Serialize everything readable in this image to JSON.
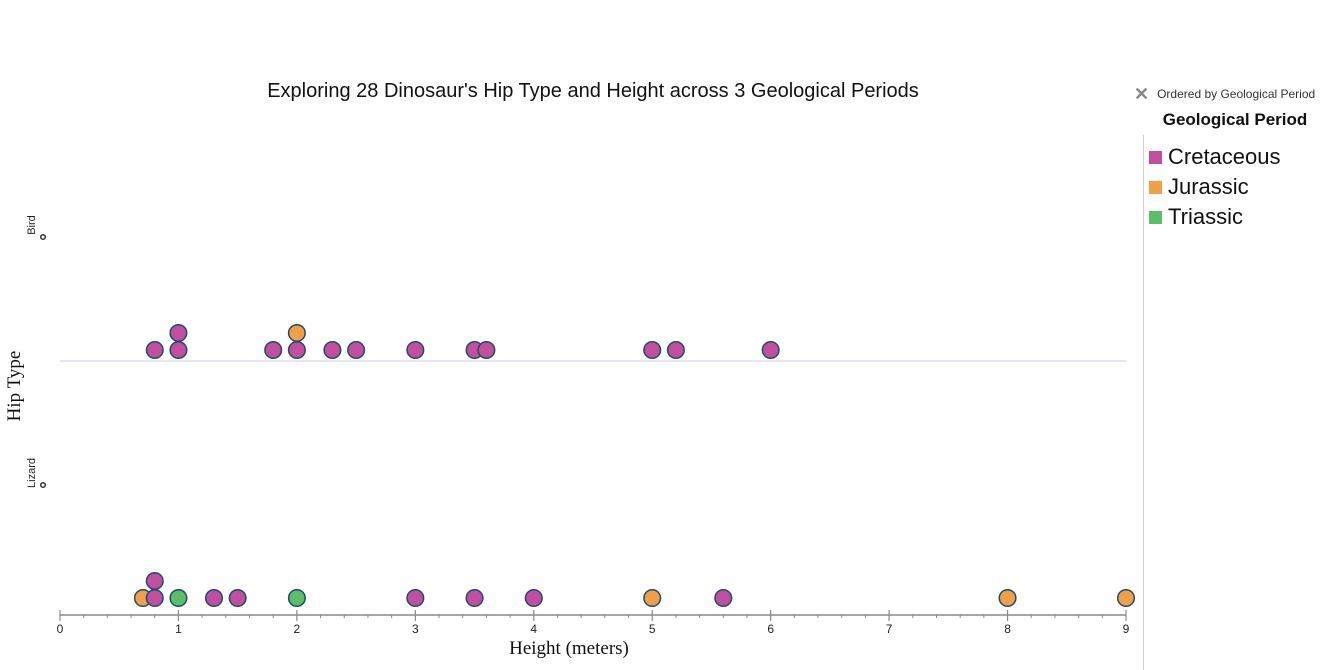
{
  "legend": {
    "ordered_by": "Ordered by Geological Period",
    "close_icon": "close-icon",
    "title": "Geological Period",
    "items": [
      {
        "label": "Cretaceous",
        "color": "#c0509f"
      },
      {
        "label": "Jurassic",
        "color": "#f0a04b"
      },
      {
        "label": "Triassic",
        "color": "#5cbe6a"
      }
    ]
  },
  "chart_data": {
    "type": "scatter",
    "subtype": "dot-plot (stacked)",
    "title": "Exploring 28 Dinosaur's Hip Type and Height across 3 Geological Periods",
    "xlabel": "Height (meters)",
    "ylabel": "Hip Type",
    "xlim": [
      0,
      9
    ],
    "x_ticks": [
      0,
      1,
      2,
      3,
      4,
      5,
      6,
      7,
      8,
      9
    ],
    "x_minor_step": 0.2,
    "categories": [
      "Bird",
      "Lizard"
    ],
    "legend_position": "right",
    "colors": {
      "Cretaceous": "#c0509f",
      "Jurassic": "#f0a04b",
      "Triassic": "#5cbe6a"
    },
    "points": [
      {
        "hip": "Bird",
        "height": 0.8,
        "period": "Cretaceous"
      },
      {
        "hip": "Bird",
        "height": 1.0,
        "period": "Cretaceous"
      },
      {
        "hip": "Bird",
        "height": 1.0,
        "period": "Cretaceous"
      },
      {
        "hip": "Bird",
        "height": 1.8,
        "period": "Cretaceous"
      },
      {
        "hip": "Bird",
        "height": 2.0,
        "period": "Cretaceous"
      },
      {
        "hip": "Bird",
        "height": 2.0,
        "period": "Jurassic"
      },
      {
        "hip": "Bird",
        "height": 2.3,
        "period": "Cretaceous"
      },
      {
        "hip": "Bird",
        "height": 2.5,
        "period": "Cretaceous"
      },
      {
        "hip": "Bird",
        "height": 3.0,
        "period": "Cretaceous"
      },
      {
        "hip": "Bird",
        "height": 3.5,
        "period": "Cretaceous"
      },
      {
        "hip": "Bird",
        "height": 3.6,
        "period": "Cretaceous"
      },
      {
        "hip": "Bird",
        "height": 5.0,
        "period": "Cretaceous"
      },
      {
        "hip": "Bird",
        "height": 5.2,
        "period": "Cretaceous"
      },
      {
        "hip": "Bird",
        "height": 6.0,
        "period": "Cretaceous"
      },
      {
        "hip": "Lizard",
        "height": 0.7,
        "period": "Jurassic"
      },
      {
        "hip": "Lizard",
        "height": 0.8,
        "period": "Cretaceous"
      },
      {
        "hip": "Lizard",
        "height": 0.8,
        "period": "Cretaceous"
      },
      {
        "hip": "Lizard",
        "height": 1.0,
        "period": "Triassic"
      },
      {
        "hip": "Lizard",
        "height": 1.3,
        "period": "Cretaceous"
      },
      {
        "hip": "Lizard",
        "height": 1.5,
        "period": "Cretaceous"
      },
      {
        "hip": "Lizard",
        "height": 2.0,
        "period": "Triassic"
      },
      {
        "hip": "Lizard",
        "height": 3.0,
        "period": "Cretaceous"
      },
      {
        "hip": "Lizard",
        "height": 3.5,
        "period": "Cretaceous"
      },
      {
        "hip": "Lizard",
        "height": 4.0,
        "period": "Cretaceous"
      },
      {
        "hip": "Lizard",
        "height": 5.0,
        "period": "Jurassic"
      },
      {
        "hip": "Lizard",
        "height": 5.6,
        "period": "Cretaceous"
      },
      {
        "hip": "Lizard",
        "height": 8.0,
        "period": "Jurassic"
      },
      {
        "hip": "Lizard",
        "height": 9.0,
        "period": "Jurassic"
      }
    ]
  }
}
